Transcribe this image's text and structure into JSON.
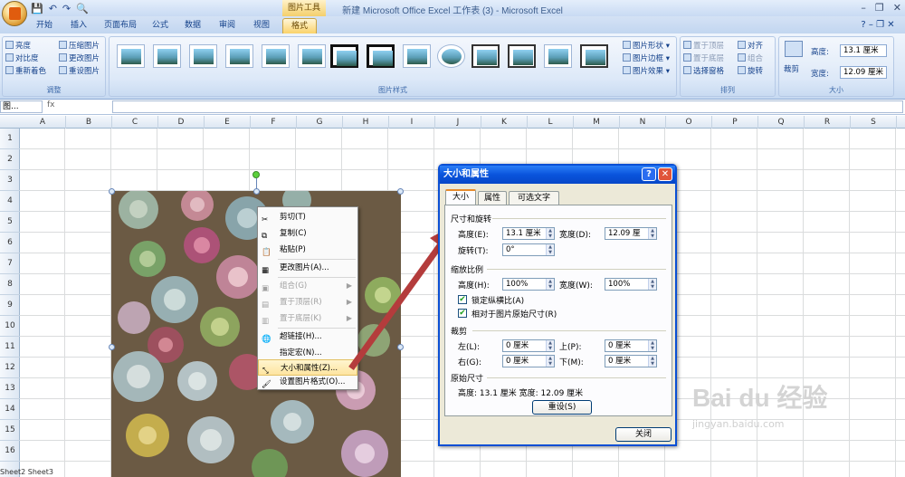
{
  "window": {
    "title": "新建 Microsoft Office Excel 工作表 (3) - Microsoft Excel",
    "context_tools": "图片工具",
    "controls": [
      "–",
      "❐",
      "✕"
    ]
  },
  "qat": [
    "💾",
    "↶",
    "↷",
    "🔍"
  ],
  "tabs": [
    "开始",
    "插入",
    "页面布局",
    "公式",
    "数据",
    "审阅",
    "视图",
    "格式"
  ],
  "ribbon": {
    "adjust": {
      "label": "调整",
      "items": [
        "亮度",
        "对比度",
        "重新着色",
        "压缩图片",
        "更改图片",
        "重设图片"
      ]
    },
    "styles": {
      "label": "图片样式",
      "options": [
        "图片形状",
        "图片边框",
        "图片效果"
      ]
    },
    "arrange": {
      "label": "排列",
      "items": [
        "置于顶层",
        "置于底层",
        "选择窗格",
        "对齐",
        "组合",
        "旋转"
      ]
    },
    "size": {
      "label": "大小",
      "crop": "裁剪",
      "height_label": "高度:",
      "height": "13.1 厘米",
      "width_label": "宽度:",
      "width": "12.09 厘米"
    }
  },
  "formula_bar": {
    "name_box": "图...",
    "fx": "fx"
  },
  "columns": [
    "A",
    "B",
    "C",
    "D",
    "E",
    "F",
    "G",
    "H",
    "I",
    "J",
    "K",
    "L",
    "M",
    "N",
    "O",
    "P",
    "Q",
    "R",
    "S"
  ],
  "rows": [
    "1",
    "2",
    "3",
    "4",
    "5",
    "6",
    "7",
    "8",
    "9",
    "10",
    "11",
    "12",
    "13",
    "14",
    "15",
    "16"
  ],
  "context_menu": [
    {
      "label": "剪切(T)",
      "disabled": false
    },
    {
      "label": "复制(C)",
      "disabled": false
    },
    {
      "label": "粘贴(P)",
      "disabled": false
    },
    {
      "label": "更改图片(A)...",
      "disabled": false
    },
    {
      "label": "组合(G)",
      "disabled": true
    },
    {
      "label": "置于顶层(R)",
      "disabled": true
    },
    {
      "label": "置于底层(K)",
      "disabled": true
    },
    {
      "label": "超链接(H)...",
      "disabled": false
    },
    {
      "label": "指定宏(N)...",
      "disabled": false
    },
    {
      "label": "大小和属性(Z)...",
      "disabled": false
    },
    {
      "label": "设置图片格式(O)...",
      "disabled": false
    }
  ],
  "dialog": {
    "title": "大小和属性",
    "help": "?",
    "close": "✕",
    "tabs": [
      "大小",
      "属性",
      "可选文字"
    ],
    "section_size": "尺寸和旋转",
    "height_label": "高度(E):",
    "height_value": "13.1 厘米",
    "width_label": "宽度(D):",
    "width_value": "12.09 厘",
    "rotate_label": "旋转(T):",
    "rotate_value": "0°",
    "section_scale": "缩放比例",
    "scale_h_label": "高度(H):",
    "scale_h_value": "100%",
    "scale_w_label": "宽度(W):",
    "scale_w_value": "100%",
    "lock_ratio": "锁定纵横比(A)",
    "relative_original": "相对于图片原始尺寸(R)",
    "section_crop": "裁剪",
    "crop_left_label": "左(L):",
    "crop_left": "0 厘米",
    "crop_top_label": "上(P):",
    "crop_top": "0 厘米",
    "crop_right_label": "右(G):",
    "crop_right": "0 厘米",
    "crop_bottom_label": "下(M):",
    "crop_bottom": "0 厘米",
    "section_original": "原始尺寸",
    "original_text": "高度:   13.1 厘米    宽度:   12.09 厘米",
    "reset": "重设(S)",
    "close_btn": "关闭"
  },
  "sheet_tabs": "Sheet2  Sheet3",
  "watermark": {
    "brand": "Bai du 经验",
    "url": "jingyan.baidu.com"
  }
}
